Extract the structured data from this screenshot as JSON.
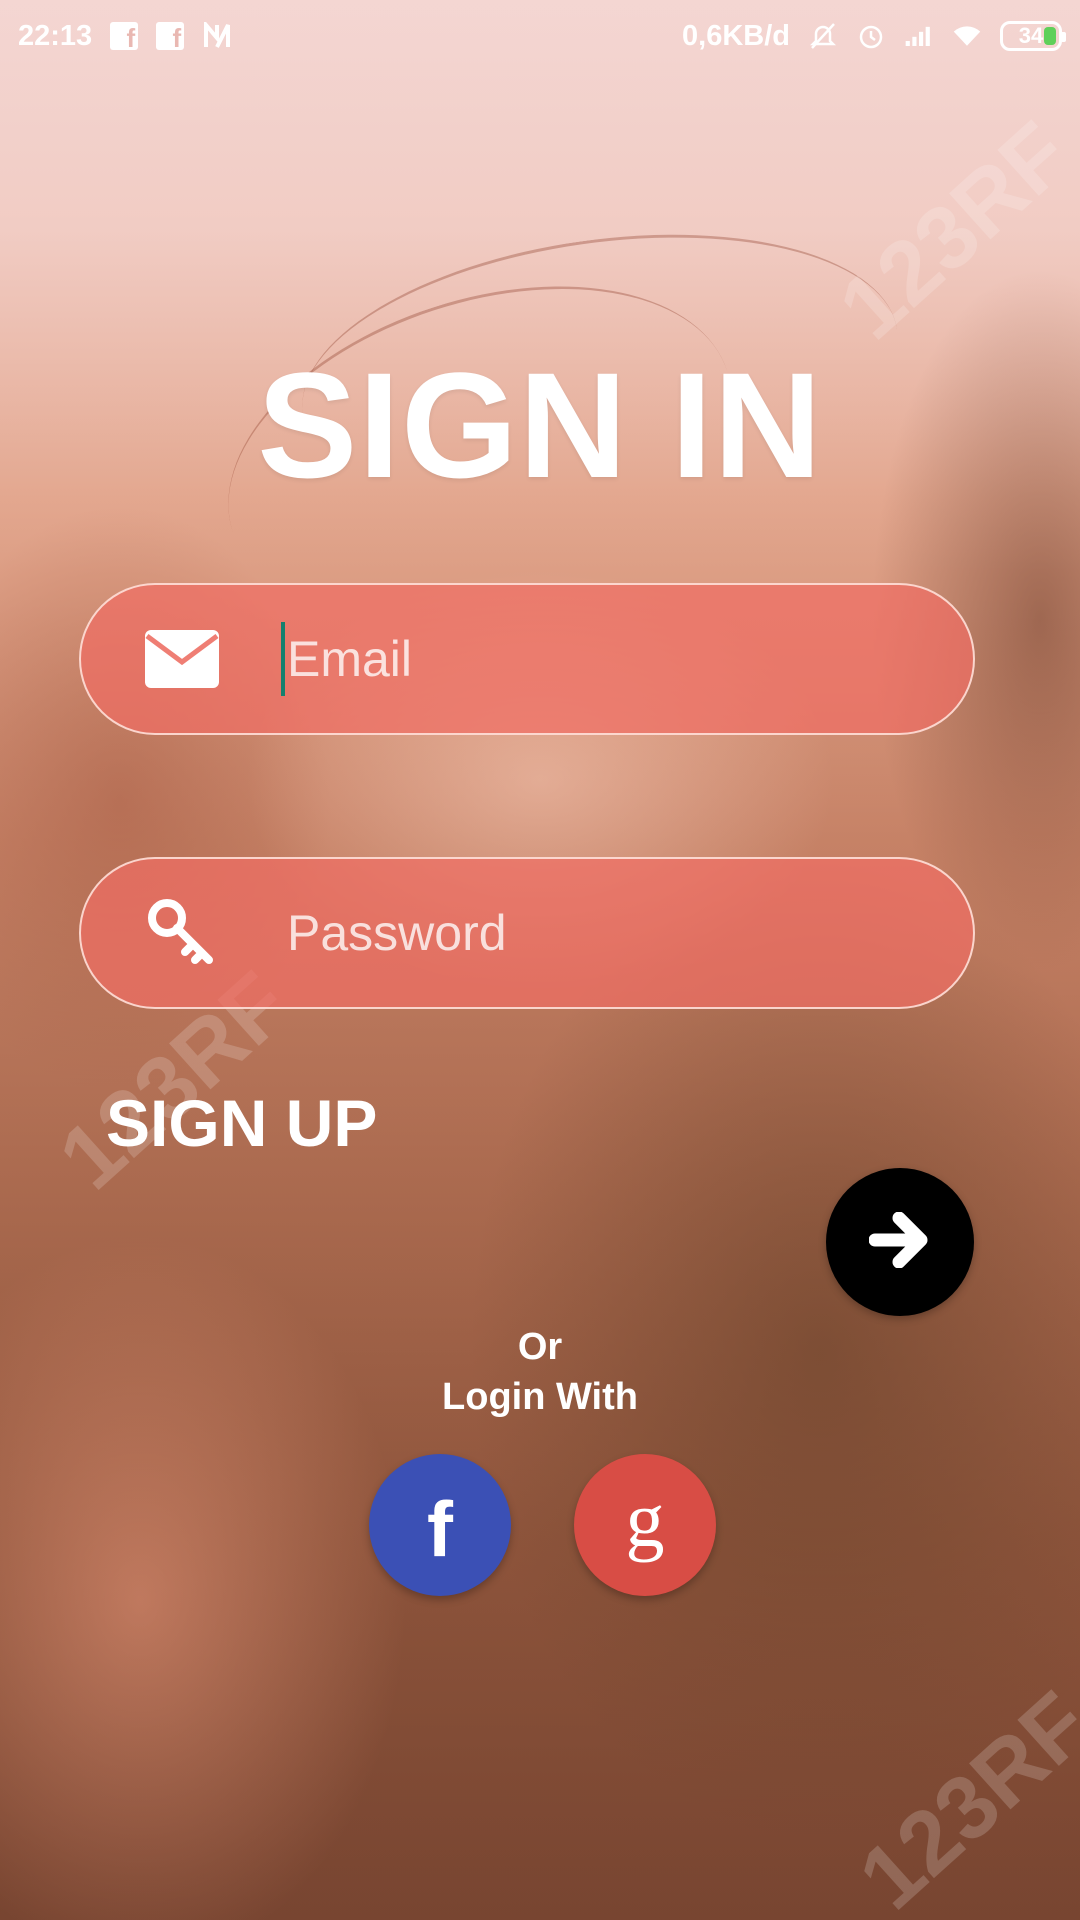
{
  "status_bar": {
    "time": "22:13",
    "left_icons": [
      "facebook-icon",
      "facebook-icon",
      "n-icon"
    ],
    "network_speed": "0,6KB/d",
    "right_icons": [
      "mute-icon",
      "alarm-icon",
      "signal-icon",
      "wifi-icon"
    ],
    "battery": "34"
  },
  "title": "SIGN IN",
  "email_field": {
    "placeholder": "Email",
    "icon": "envelope-icon"
  },
  "password_field": {
    "placeholder": "Password",
    "icon": "key-icon"
  },
  "signup_label": "SIGN UP",
  "submit_icon": "arrow-right-icon",
  "alt_login": {
    "line1": "Or",
    "line2": "Login With"
  },
  "social": {
    "facebook": {
      "glyph": "f",
      "color": "#3b50b5"
    },
    "google": {
      "glyph": "g",
      "color": "#d84d45"
    }
  },
  "colors": {
    "field_fill": "#f06e64",
    "submit_button": "#000000",
    "caret": "#14806e"
  }
}
